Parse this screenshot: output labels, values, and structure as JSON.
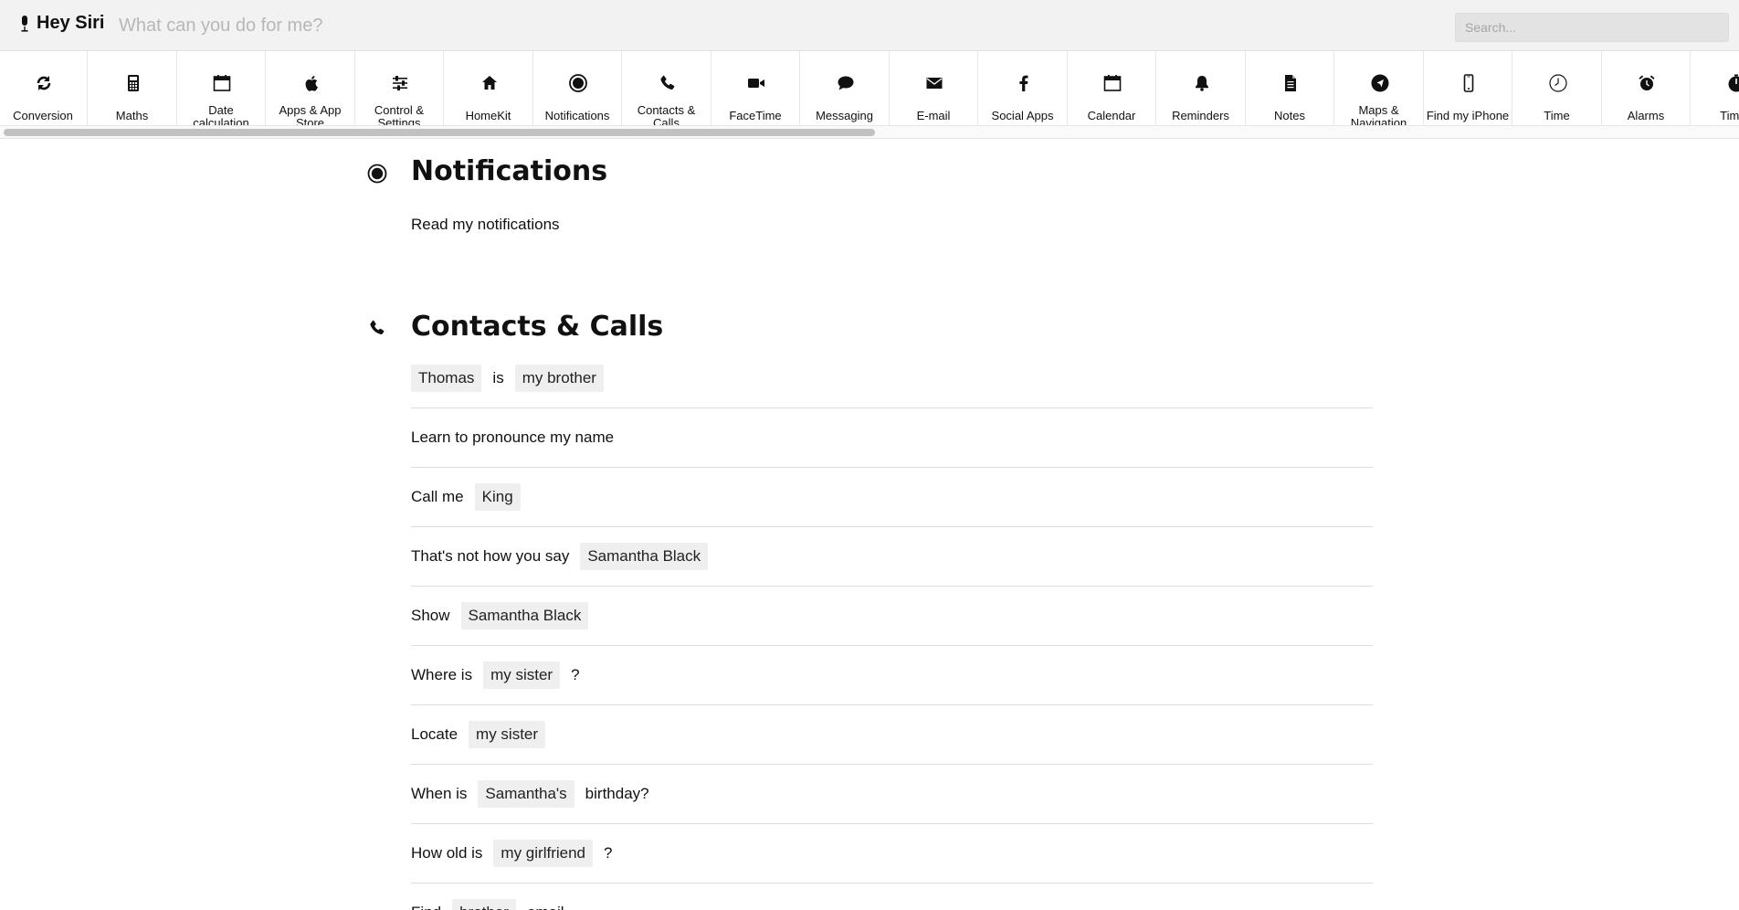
{
  "header": {
    "brand": "Hey Siri",
    "tagline": "What can you do for me?",
    "search_placeholder": "Search..."
  },
  "categories": [
    {
      "label": "Conversion",
      "icon": "refresh-icon"
    },
    {
      "label": "Maths",
      "icon": "calculator-icon"
    },
    {
      "label": "Date calculation",
      "icon": "calendar-icon"
    },
    {
      "label": "Apps & App Store",
      "icon": "apple-icon"
    },
    {
      "label": "Control & Settings",
      "icon": "sliders-icon"
    },
    {
      "label": "HomeKit",
      "icon": "home-icon"
    },
    {
      "label": "Notifications",
      "icon": "record-icon"
    },
    {
      "label": "Contacts & Calls",
      "icon": "phone-icon"
    },
    {
      "label": "FaceTime",
      "icon": "video-icon"
    },
    {
      "label": "Messaging",
      "icon": "chat-bubble-icon"
    },
    {
      "label": "E-mail",
      "icon": "envelope-icon"
    },
    {
      "label": "Social Apps",
      "icon": "facebook-icon"
    },
    {
      "label": "Calendar",
      "icon": "calendar-icon"
    },
    {
      "label": "Reminders",
      "icon": "bell-icon"
    },
    {
      "label": "Notes",
      "icon": "document-icon"
    },
    {
      "label": "Maps & Navigation",
      "icon": "navigation-icon"
    },
    {
      "label": "Find my iPhone",
      "icon": "mobile-icon"
    },
    {
      "label": "Time",
      "icon": "clock-icon"
    },
    {
      "label": "Alarms",
      "icon": "alarm-icon"
    },
    {
      "label": "Timer",
      "icon": "timer-icon"
    }
  ],
  "notifications": {
    "title": "Notifications",
    "rows": [
      {
        "parts": [
          {
            "text": "Read my notifications"
          }
        ]
      }
    ]
  },
  "contacts": {
    "title": "Contacts & Calls",
    "rows": [
      {
        "parts": [
          {
            "tag": "Thomas"
          },
          {
            "text": "is"
          },
          {
            "tag": "my brother"
          }
        ]
      },
      {
        "parts": [
          {
            "text": "Learn to pronounce my name"
          }
        ]
      },
      {
        "parts": [
          {
            "text": "Call me"
          },
          {
            "tag": "King"
          }
        ]
      },
      {
        "parts": [
          {
            "text": "That's not how you say"
          },
          {
            "tag": "Samantha Black"
          }
        ]
      },
      {
        "parts": [
          {
            "text": "Show"
          },
          {
            "tag": "Samantha Black"
          }
        ]
      },
      {
        "parts": [
          {
            "text": "Where is"
          },
          {
            "tag": "my sister"
          },
          {
            "text": "?"
          }
        ]
      },
      {
        "parts": [
          {
            "text": "Locate"
          },
          {
            "tag": "my sister"
          }
        ]
      },
      {
        "parts": [
          {
            "text": "When is"
          },
          {
            "tag": "Samantha's"
          },
          {
            "text": "birthday?"
          }
        ]
      },
      {
        "parts": [
          {
            "text": "How old is"
          },
          {
            "tag": "my girlfriend"
          },
          {
            "text": "?"
          }
        ]
      },
      {
        "parts": [
          {
            "text": "Find"
          },
          {
            "tag": "brother"
          },
          {
            "text": "email"
          }
        ]
      }
    ]
  }
}
